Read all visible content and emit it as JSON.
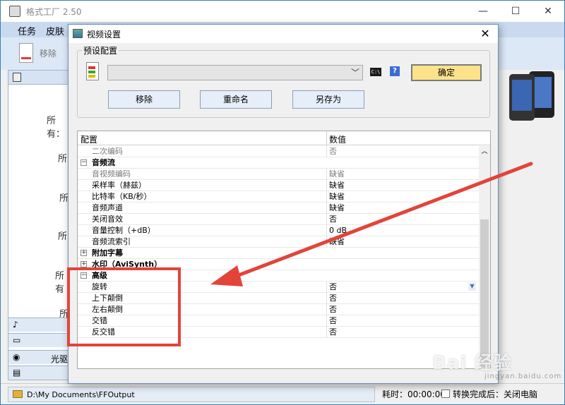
{
  "main_window": {
    "title": "格式工厂 2.50",
    "controls": {
      "minimize": "—",
      "maximize": "☐",
      "close": "✕"
    },
    "menu": [
      "任务",
      "皮肤"
    ],
    "toolbar": {
      "remove_label": "移除"
    },
    "left_panel": {
      "all_labels": [
        "所有：",
        "所",
        "所",
        "所",
        "所有",
        "所"
      ],
      "tabs": [
        {
          "glyph": "♪",
          "label": ""
        },
        {
          "glyph": "▭",
          "label": ""
        },
        {
          "glyph": "◉",
          "label": "光驱"
        },
        {
          "glyph": "▤",
          "label": ""
        }
      ]
    },
    "status": {
      "output_path": "D:\\My Documents\\FFOutput",
      "elapsed": "耗时：00:00:00",
      "after_convert": "转换完成后：关闭电脑"
    }
  },
  "dialog": {
    "title": "视频设置",
    "close": "✕",
    "preset_group_label": "预设配置",
    "preset_value": "",
    "cmd_icon_text": "C:\\",
    "help_icon_text": "?",
    "ok_label": "确定",
    "buttons": {
      "remove": "移除",
      "rename": "重命名",
      "save_as": "另存为"
    },
    "grid": {
      "headers": {
        "config": "配置",
        "value": "数值"
      },
      "rows": [
        {
          "name": "二次编码",
          "value": "否",
          "kind": "muted"
        },
        {
          "name": "音频流",
          "value": "",
          "kind": "section",
          "toggle": "−"
        },
        {
          "name": "音视频编码",
          "value": "缺省",
          "kind": "muted"
        },
        {
          "name": "采样率（赫兹）",
          "value": "缺省",
          "kind": "normal"
        },
        {
          "name": "比特率（KB/秒）",
          "value": "缺省",
          "kind": "normal"
        },
        {
          "name": "音频声道",
          "value": "缺省",
          "kind": "normal"
        },
        {
          "name": "关闭音效",
          "value": "否",
          "kind": "normal"
        },
        {
          "name": "音量控制（+dB）",
          "value": "0 dB",
          "kind": "normal"
        },
        {
          "name": "音频流索引",
          "value": "缺省",
          "kind": "normal"
        },
        {
          "name": "附加字幕",
          "value": "",
          "kind": "section",
          "toggle": "+"
        },
        {
          "name": "水印（AviSynth）",
          "value": "",
          "kind": "section",
          "toggle": "+"
        },
        {
          "name": "高级",
          "value": "",
          "kind": "section",
          "toggle": "−"
        },
        {
          "name": "旋转",
          "value": "否",
          "kind": "selected"
        },
        {
          "name": "上下颠倒",
          "value": "否",
          "kind": "normal"
        },
        {
          "name": "左右颠倒",
          "value": "否",
          "kind": "normal"
        },
        {
          "name": "交错",
          "value": "否",
          "kind": "normal"
        },
        {
          "name": "反交错",
          "value": "否",
          "kind": "normal"
        }
      ]
    }
  },
  "watermark": {
    "main": "Bai 经验",
    "sub": "jingyan.baidu.com"
  },
  "colors": {
    "annotation": "#e2443a",
    "ok_button": "#fce28a",
    "menubar": "#c9daf0"
  }
}
